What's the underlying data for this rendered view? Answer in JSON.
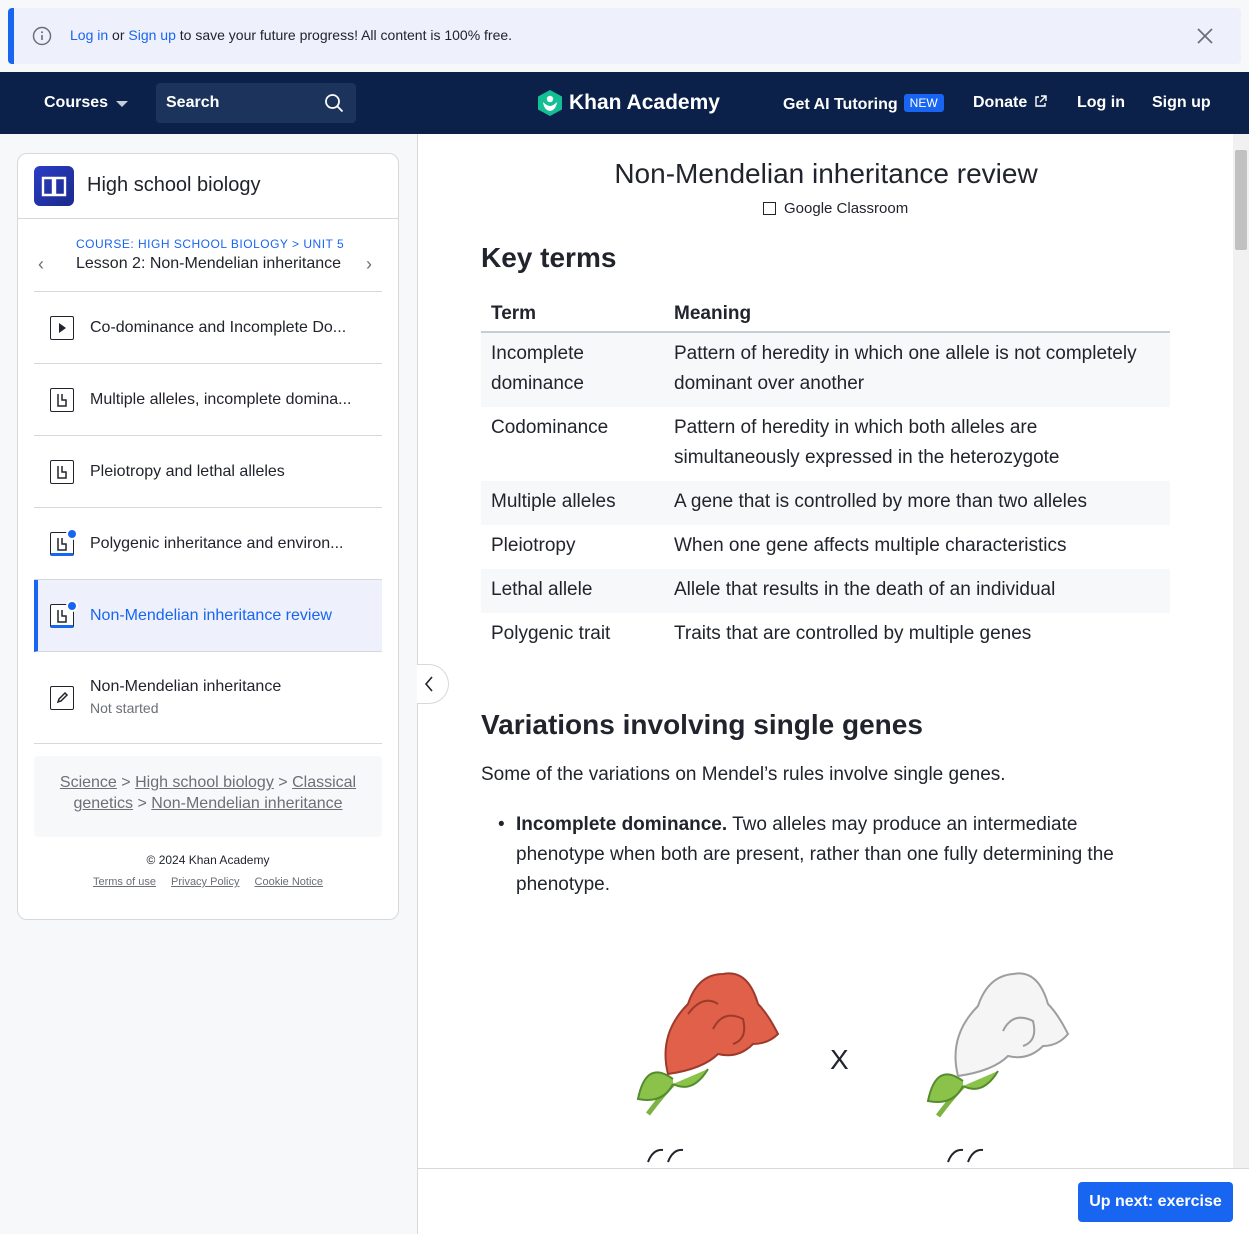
{
  "banner": {
    "login": "Log in",
    "or": "or",
    "signup": "Sign up",
    "message": "to save your future progress! All content is 100% free."
  },
  "nav": {
    "courses": "Courses",
    "search": "Search",
    "logo": "Khan Academy",
    "ai_tutoring": "Get AI Tutoring",
    "new_badge": "NEW",
    "donate": "Donate",
    "login": "Log in",
    "signup": "Sign up"
  },
  "sidebar": {
    "course_title": "High school biology",
    "crumb": "COURSE: HIGH SCHOOL BIOLOGY > UNIT 5",
    "lesson": "Lesson 2: Non-Mendelian inheritance",
    "items": [
      {
        "label": "Co-dominance and Incomplete Do...",
        "type": "video"
      },
      {
        "label": "Multiple alleles, incomplete domina...",
        "type": "article"
      },
      {
        "label": "Pleiotropy and lethal alleles",
        "type": "article"
      },
      {
        "label": "Polygenic inheritance and environ...",
        "type": "article",
        "completed": true
      },
      {
        "label": "Non-Mendelian inheritance review",
        "type": "article",
        "completed": true,
        "active": true
      },
      {
        "label": "Non-Mendelian inheritance",
        "sub": "Not started",
        "type": "exercise"
      }
    ],
    "breadcrumbs": [
      "Science",
      "High school biology",
      "Classical genetics",
      "Non-Mendelian inheritance"
    ],
    "copyright": "© 2024 Khan Academy",
    "footer_links": [
      "Terms of use",
      "Privacy Policy",
      "Cookie Notice"
    ]
  },
  "main": {
    "title": "Non-Mendelian inheritance review",
    "google_classroom": "Google Classroom",
    "key_terms_heading": "Key terms",
    "table_headers": [
      "Term",
      "Meaning"
    ],
    "table_rows": [
      [
        "Incomplete dominance",
        "Pattern of heredity in which one allele is not completely dominant over another"
      ],
      [
        "Codominance",
        "Pattern of heredity in which both alleles are simultaneously expressed in the heterozygote"
      ],
      [
        "Multiple alleles",
        "A gene that is controlled by more than two alleles"
      ],
      [
        "Pleiotropy",
        "When one gene affects multiple characteristics"
      ],
      [
        "Lethal allele",
        "Allele that results in the death of an individual"
      ],
      [
        "Polygenic trait",
        "Traits that are controlled by multiple genes"
      ]
    ],
    "variations_heading": "Variations involving single genes",
    "variations_intro": "Some of the variations on Mendel’s rules involve single genes.",
    "bullet_bold": "Incomplete dominance.",
    "bullet_text": " Two alleles may produce an intermediate phenotype when both are present, rather than one fully determining the phenotype.",
    "figure_cross": "X",
    "up_next": "Up next: exercise"
  }
}
